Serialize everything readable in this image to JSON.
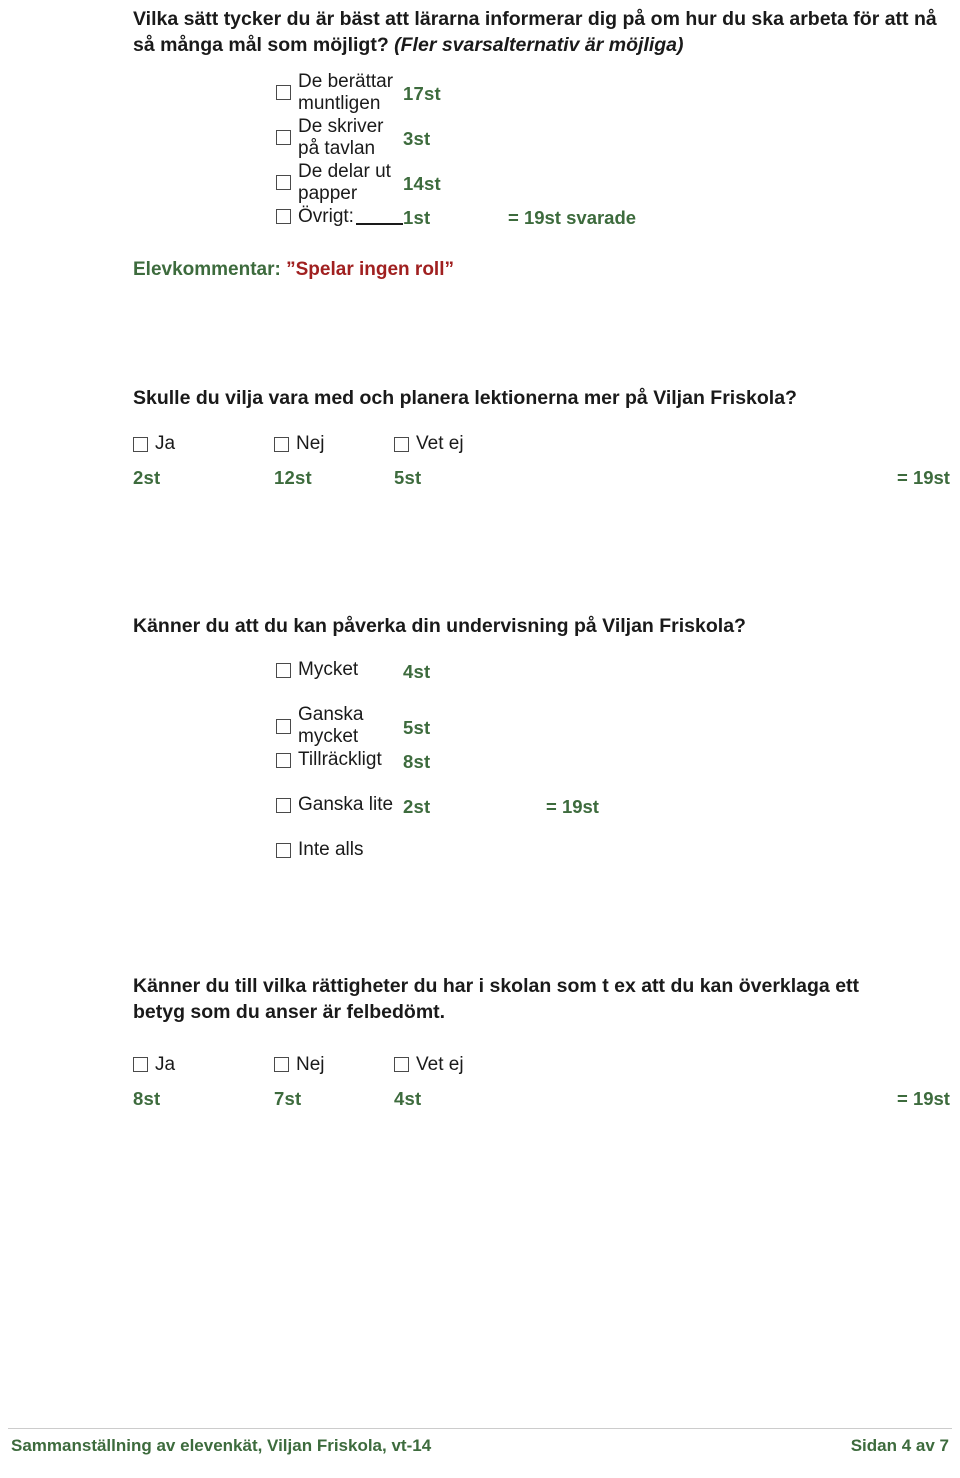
{
  "blocks": [
    {
      "title_main": "Vilka sätt tycker du är bäst att lärarna informerar dig på om hur du ska arbeta för att nå så många mål som möjligt?",
      "title_italic": "(Fler svarsalternativ är möjliga)",
      "options": [
        {
          "label": "De berättar muntligen",
          "count": "17st"
        },
        {
          "label": "De skriver på tavlan",
          "count": "3st"
        },
        {
          "label": "De delar ut papper",
          "count": "14st"
        },
        {
          "label": "Övrigt:",
          "count": "1st"
        }
      ],
      "total": "= 19st svarade",
      "comment_label": "Elevkommentar:",
      "comment_value": "”Spelar ingen roll”"
    },
    {
      "title_main": "Skulle du vilja vara med och planera lektionerna mer på Viljan Friskola?",
      "options": [
        {
          "label": "Ja",
          "count": "2st"
        },
        {
          "label": "Nej",
          "count": "12st"
        },
        {
          "label": "Vet ej",
          "count": "5st"
        }
      ],
      "total": "= 19st"
    },
    {
      "title_main": "Känner du att du kan påverka din undervisning på Viljan Friskola?",
      "options": [
        {
          "label": "Mycket",
          "count": "4st"
        },
        {
          "label": "Ganska mycket",
          "count": "5st"
        },
        {
          "label": "Tillräckligt",
          "count": "8st"
        },
        {
          "label": "Ganska lite",
          "count": "2st"
        },
        {
          "label": "Inte alls",
          "count": ""
        }
      ],
      "total": "= 19st"
    },
    {
      "title_main": "Känner du till vilka rättigheter du har i skolan som t ex att du kan överklaga ett betyg som du anser är felbedömt.",
      "options": [
        {
          "label": "Ja",
          "count": "8st"
        },
        {
          "label": "Nej",
          "count": "7st"
        },
        {
          "label": "Vet ej",
          "count": "4st"
        }
      ],
      "total": "= 19st"
    }
  ],
  "footer": {
    "left": "Sammanställning av elevenkät, Viljan Friskola, vt-14",
    "right": "Sidan 4 av 7"
  },
  "colors": {
    "count_green": "#3d6b3d",
    "comment_red": "#a02020",
    "text": "#1a1a1a"
  }
}
